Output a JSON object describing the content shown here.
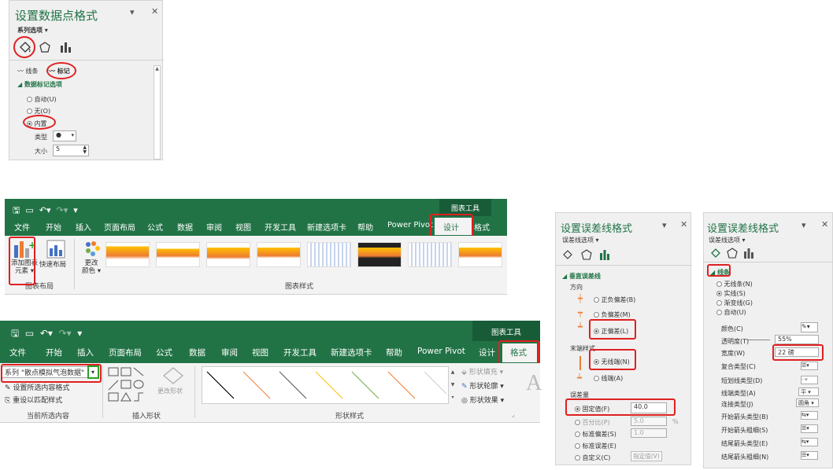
{
  "panel1": {
    "title": "设置数据点格式",
    "series_options": "系列选项",
    "tabs": [
      "线条",
      "标记"
    ],
    "section": "数据标记选项",
    "radios": [
      "自动(U)",
      "无(O)",
      "内置"
    ],
    "type_label": "类型",
    "type_value": "●",
    "size_label": "大小",
    "size_value": "5"
  },
  "ribbon1": {
    "context_label": "图表工具",
    "tabs": [
      "文件",
      "开始",
      "插入",
      "页面布局",
      "公式",
      "数据",
      "审阅",
      "视图",
      "开发工具",
      "新建选项卡",
      "帮助",
      "Power Pivot",
      "设计",
      "格式"
    ],
    "add_element_line1": "添加图表",
    "add_element_line2": "元素",
    "quick_layout": "快速布局",
    "change_color_line1": "更改",
    "change_color_line2": "颜色",
    "group_layout": "图表布局",
    "group_styles": "图表样式"
  },
  "ribbon2": {
    "context_label": "图表工具",
    "tabs": [
      "文件",
      "开始",
      "插入",
      "页面布局",
      "公式",
      "数据",
      "审阅",
      "视图",
      "开发工具",
      "新建选项卡",
      "帮助",
      "Power Pivot",
      "设计",
      "格式"
    ],
    "series_select": "系列 \"散点模拟气泡数据\"",
    "format_selection": "设置所选内容格式",
    "reset_style": "重设以匹配样式",
    "group_current": "当前所选内容",
    "change_shape": "更改形状",
    "group_insert": "插入形状",
    "group_shape_styles": "形状样式",
    "shape_fill": "形状填充",
    "shape_outline": "形状轮廓",
    "shape_effects": "形状效果"
  },
  "panel2": {
    "title": "设置误差线格式",
    "options_label": "误差线选项",
    "section": "垂直误差线",
    "direction_label": "方向",
    "directions": [
      "正负偏差(B)",
      "负偏差(M)",
      "正偏差(L)"
    ],
    "end_style_label": "末端样式",
    "end_styles": [
      "无线端(N)",
      "线端(A)"
    ],
    "amount_label": "误差量",
    "amounts": [
      "固定值(F)",
      "百分比(P)",
      "标准偏差(S)",
      "标准误差(E)",
      "自定义(C)"
    ],
    "fixed_value": "40.0",
    "percent_value": "5.0",
    "percent_unit": "%",
    "stddev_value": "1.0",
    "specify_button": "指定值(V)"
  },
  "panel3": {
    "title": "设置误差线格式",
    "options_label": "误差线选项",
    "section": "线条",
    "radios": [
      "无线条(N)",
      "实线(S)",
      "渐变线(G)",
      "自动(U)"
    ],
    "props": [
      "颜色(C)",
      "透明度(T)",
      "宽度(W)",
      "复合类型(C)",
      "短划线类型(D)",
      "线端类型(A)",
      "连接类型(J)",
      "开始箭头类型(B)",
      "开始箭头粗细(S)",
      "结尾箭头类型(E)",
      "结尾箭头粗细(N)"
    ],
    "transparency_value": "55%",
    "width_value": "22 磅",
    "line_cap_value": "平",
    "join_value": "圆角"
  },
  "colors": {
    "excel_green": "#217346",
    "highlight_red": "#e02020",
    "select_green": "#2aa02a"
  }
}
